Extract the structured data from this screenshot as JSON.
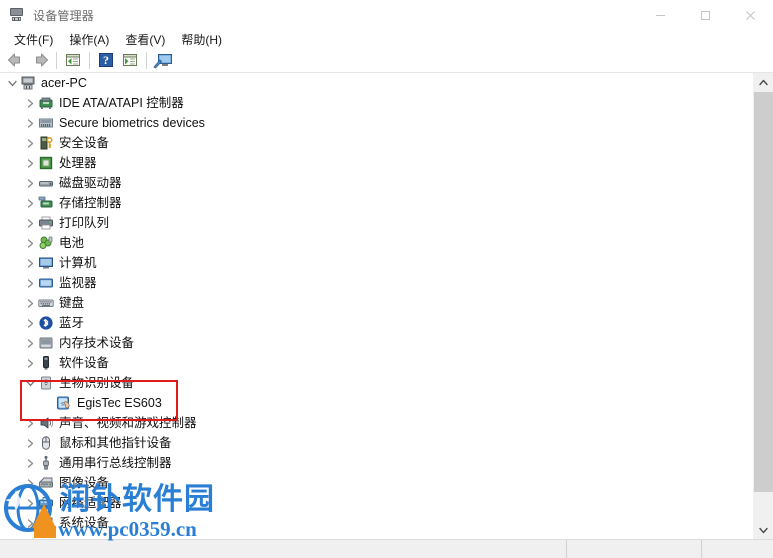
{
  "window": {
    "title": "设备管理器",
    "icon": "device-manager-icon",
    "controls": {
      "minimize": "−",
      "maximize": "□",
      "close": "✕"
    }
  },
  "menubar": {
    "items": [
      {
        "label": "文件(F)",
        "name": "menu-file"
      },
      {
        "label": "操作(A)",
        "name": "menu-action"
      },
      {
        "label": "查看(V)",
        "name": "menu-view"
      },
      {
        "label": "帮助(H)",
        "name": "menu-help"
      }
    ]
  },
  "toolbar": {
    "buttons": [
      {
        "name": "back-button",
        "icon": "back-arrow-icon",
        "title": "后退"
      },
      {
        "name": "forward-button",
        "icon": "forward-arrow-icon",
        "title": "前进"
      },
      {
        "name": "separator-1",
        "icon": "separator"
      },
      {
        "name": "show-hidden-button",
        "icon": "list-left-icon",
        "title": "属性"
      },
      {
        "name": "separator-2",
        "icon": "separator"
      },
      {
        "name": "help-button",
        "icon": "help-question-icon",
        "title": "帮助"
      },
      {
        "name": "properties-button",
        "icon": "list-right-icon",
        "title": "更新驱动程序"
      },
      {
        "name": "separator-3",
        "icon": "separator"
      },
      {
        "name": "scan-hardware-button",
        "icon": "monitor-scan-icon",
        "title": "扫描检测硬件改动"
      }
    ]
  },
  "tree": {
    "root": {
      "label": "acer-PC",
      "expanded": true,
      "icon": "computer-icon"
    },
    "items": [
      {
        "label": "IDE ATA/ATAPI 控制器",
        "icon": "ide-controller-icon",
        "expanded": false,
        "level": 1
      },
      {
        "label": "Secure biometrics devices",
        "icon": "biometrics-icon",
        "expanded": false,
        "level": 1
      },
      {
        "label": "安全设备",
        "icon": "security-device-icon",
        "expanded": false,
        "level": 1
      },
      {
        "label": "处理器",
        "icon": "processor-icon",
        "expanded": false,
        "level": 1
      },
      {
        "label": "磁盘驱动器",
        "icon": "disk-drive-icon",
        "expanded": false,
        "level": 1
      },
      {
        "label": "存储控制器",
        "icon": "storage-controller-icon",
        "expanded": false,
        "level": 1
      },
      {
        "label": "打印队列",
        "icon": "print-queue-icon",
        "expanded": false,
        "level": 1
      },
      {
        "label": "电池",
        "icon": "battery-icon",
        "expanded": false,
        "level": 1
      },
      {
        "label": "计算机",
        "icon": "computer-node-icon",
        "expanded": false,
        "level": 1
      },
      {
        "label": "监视器",
        "icon": "monitor-icon",
        "expanded": false,
        "level": 1
      },
      {
        "label": "键盘",
        "icon": "keyboard-icon",
        "expanded": false,
        "level": 1
      },
      {
        "label": "蓝牙",
        "icon": "bluetooth-icon",
        "expanded": false,
        "level": 1
      },
      {
        "label": "内存技术设备",
        "icon": "memory-technology-icon",
        "expanded": false,
        "level": 1
      },
      {
        "label": "软件设备",
        "icon": "software-device-icon",
        "expanded": false,
        "level": 1
      },
      {
        "label": "生物识别设备",
        "icon": "biometric-device-icon",
        "expanded": true,
        "level": 1,
        "highlighted": true
      },
      {
        "label": "EgisTec ES603",
        "icon": "fingerprint-reader-icon",
        "expanded": null,
        "level": 2,
        "highlighted": true
      },
      {
        "label": "声音、视频和游戏控制器",
        "icon": "sound-video-game-icon",
        "expanded": false,
        "level": 1
      },
      {
        "label": "鼠标和其他指针设备",
        "icon": "mouse-icon",
        "expanded": false,
        "level": 1
      },
      {
        "label": "通用串行总线控制器",
        "icon": "usb-controller-icon",
        "expanded": false,
        "level": 1
      },
      {
        "label": "图像设备",
        "icon": "imaging-device-icon",
        "expanded": false,
        "level": 1
      },
      {
        "label": "网络适配器",
        "icon": "network-adapter-icon",
        "expanded": false,
        "level": 1
      },
      {
        "label": "系统设备",
        "icon": "system-device-icon",
        "expanded": false,
        "level": 1
      }
    ]
  },
  "highlight": {
    "color": "#e01b1b",
    "name": "red-annotation-box"
  },
  "scrollbar": {
    "up_arrow": "▲",
    "down_arrow": "▼"
  },
  "statusbar": {
    "message": "",
    "pane1": "",
    "pane2": ""
  },
  "watermark": {
    "site_name": "润钋软件园",
    "url": "www.pc0359.cn",
    "color": "#2a7fd4"
  }
}
